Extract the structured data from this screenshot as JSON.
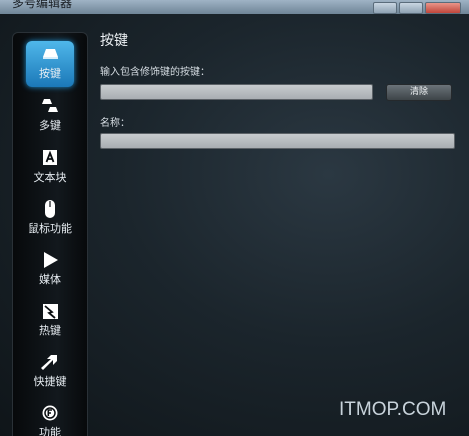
{
  "window": {
    "title": "多号编辑器"
  },
  "sidebar": {
    "items": [
      {
        "label": "按键",
        "icon": "keycap-icon",
        "active": true
      },
      {
        "label": "多键",
        "icon": "multi-key-icon",
        "active": false
      },
      {
        "label": "文本块",
        "icon": "text-block-icon",
        "active": false
      },
      {
        "label": "鼠标功能",
        "icon": "mouse-icon",
        "active": false
      },
      {
        "label": "媒体",
        "icon": "play-icon",
        "active": false
      },
      {
        "label": "热键",
        "icon": "hotkey-icon",
        "active": false
      },
      {
        "label": "快捷键",
        "icon": "shortcut-arrow-icon",
        "active": false
      },
      {
        "label": "功能",
        "icon": "function-gear-icon",
        "active": false
      }
    ]
  },
  "main": {
    "title": "按键",
    "keystroke_label": "输入包含修饰键的按键：",
    "keystroke_value": "",
    "clear_button": "清除",
    "name_label": "名称：",
    "name_value": ""
  },
  "watermark": "ITMOP.COM",
  "colors": {
    "accent": "#2a95d6",
    "background": "#1b252c",
    "sidebar": "#0b0f12"
  }
}
